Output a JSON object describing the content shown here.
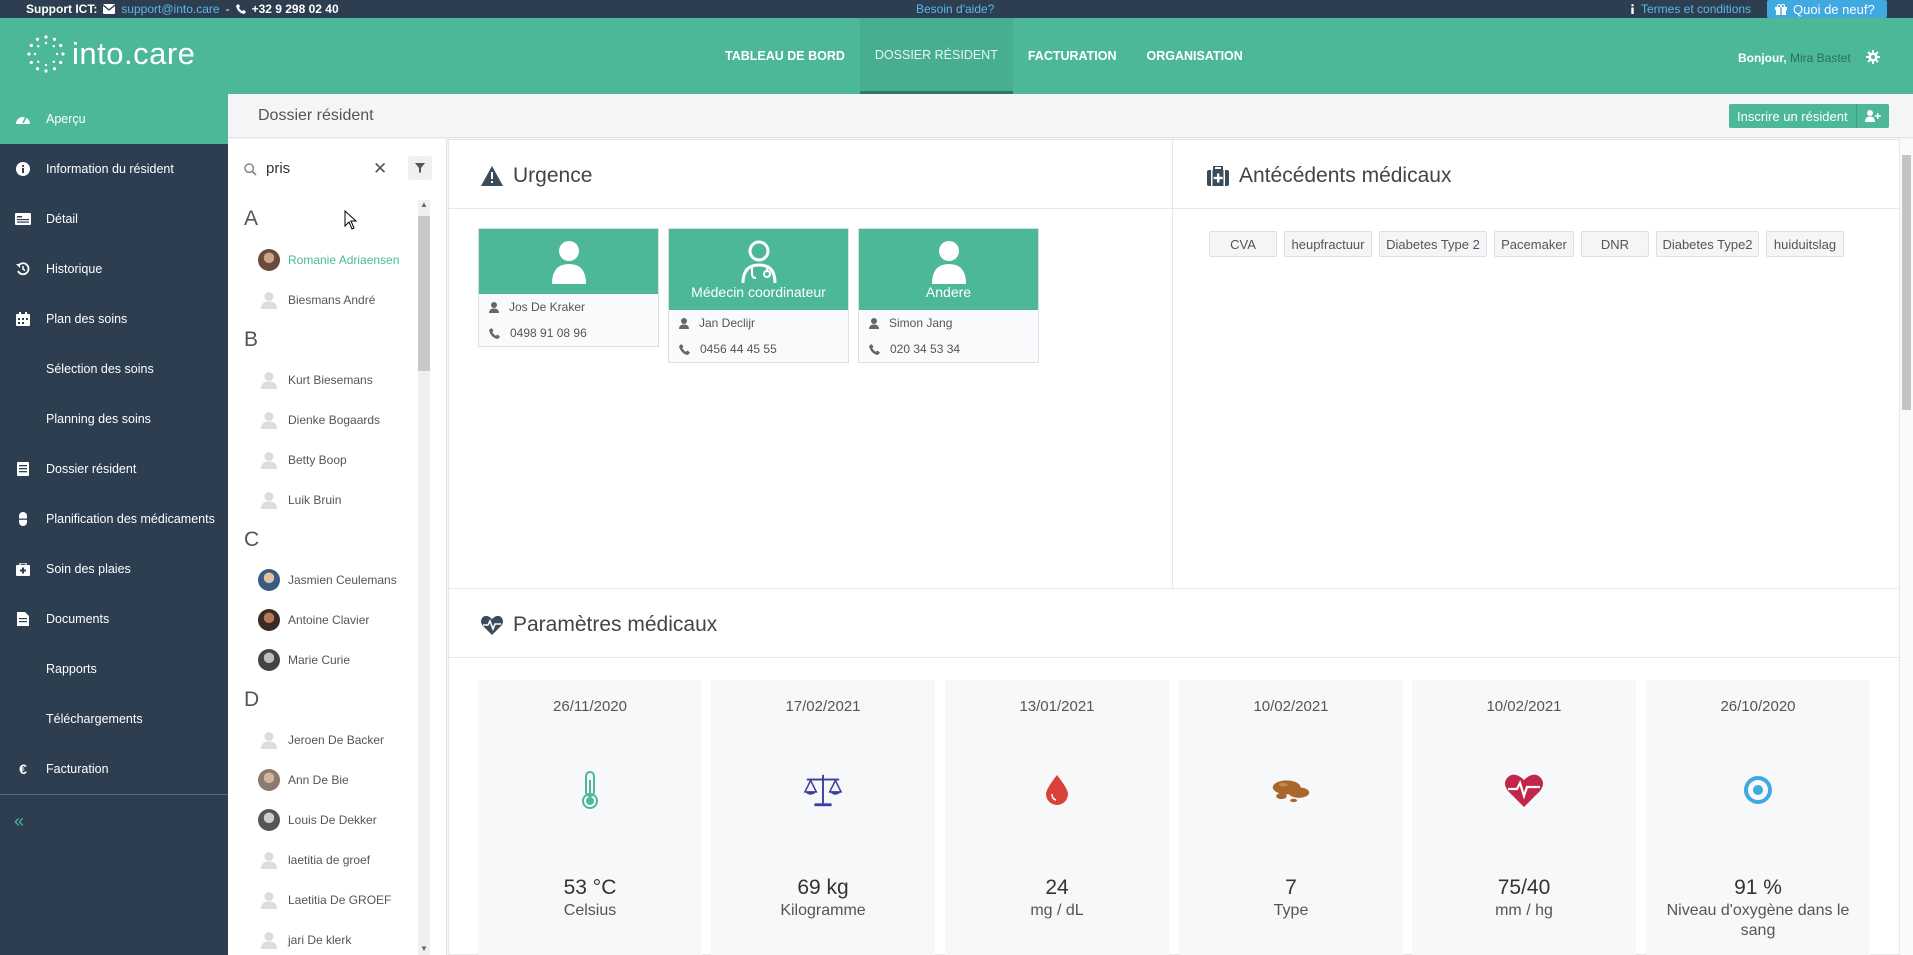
{
  "support": {
    "label": "Support ICT:",
    "email": "support@into.care",
    "sep": "-",
    "phone": "+32 9 298 02 40",
    "help": "Besoin d'aide?",
    "terms": "Termes et conditions",
    "whats_new": "Quoi de neuf?"
  },
  "header": {
    "logo": "into.care",
    "nav": [
      "TABLEAU DE BORD",
      "DOSSIER RÉSIDENT",
      "FACTURATION",
      "ORGANISATION"
    ],
    "greeting": "Bonjour,",
    "user": "Mira Bastet"
  },
  "sidebar": {
    "items": [
      {
        "label": "Aperçu",
        "icon": "dashboard-icon"
      },
      {
        "label": "Information du résident",
        "icon": "info-icon"
      },
      {
        "label": "Détail",
        "icon": "id-card-icon"
      },
      {
        "label": "Historique",
        "icon": "history-icon"
      },
      {
        "label": "Plan des soins",
        "icon": "calendar-icon"
      },
      {
        "label": "Sélection des soins",
        "icon": ""
      },
      {
        "label": "Planning des soins",
        "icon": ""
      },
      {
        "label": "Dossier résident",
        "icon": "list-icon"
      },
      {
        "label": "Planification des médicaments",
        "icon": "pill-icon"
      },
      {
        "label": "Soin des plaies",
        "icon": "first-aid-icon"
      },
      {
        "label": "Documents",
        "icon": "document-icon"
      },
      {
        "label": "Rapports",
        "icon": ""
      },
      {
        "label": "Téléchargements",
        "icon": ""
      },
      {
        "label": "Facturation",
        "icon": "euro-icon"
      }
    ],
    "collapse": "«"
  },
  "subheader": {
    "title": "Dossier résident",
    "register_button": "Inscrire un résident"
  },
  "search": {
    "value": "pris",
    "placeholder": ""
  },
  "residents": {
    "groups": [
      {
        "letter": "A",
        "items": [
          {
            "name": "Romanie Adriaensen",
            "photo": true,
            "selected": true
          },
          {
            "name": "Biesmans André",
            "photo": false
          }
        ]
      },
      {
        "letter": "B",
        "items": [
          {
            "name": "Kurt Biesemans",
            "photo": false
          },
          {
            "name": "Dienke Bogaards",
            "photo": false
          },
          {
            "name": "Betty Boop",
            "photo": false
          },
          {
            "name": "Luik Bruin",
            "photo": false
          }
        ]
      },
      {
        "letter": "C",
        "items": [
          {
            "name": "Jasmien Ceulemans",
            "photo": true
          },
          {
            "name": "Antoine Clavier",
            "photo": true
          },
          {
            "name": "Marie Curie",
            "photo": true
          }
        ]
      },
      {
        "letter": "D",
        "items": [
          {
            "name": "Jeroen De Backer",
            "photo": false
          },
          {
            "name": "Ann De Bie",
            "photo": true,
            "case": true
          },
          {
            "name": "Louis De Dekker",
            "photo": true
          },
          {
            "name": "laetitia de groef",
            "photo": false
          },
          {
            "name": "Laetitia De GROEF",
            "photo": false,
            "case": true
          },
          {
            "name": "jari De klerk",
            "photo": false
          }
        ]
      }
    ]
  },
  "urgence": {
    "title": "Urgence",
    "contacts": [
      {
        "role": "",
        "name": "Jos De Kraker",
        "phone": "0498 91 08 96"
      },
      {
        "role": "Médecin coordinateur",
        "name": "Jan Declijr",
        "phone": "0456 44 45 55"
      },
      {
        "role": "Andere",
        "name": "Simon Jang",
        "phone": "020 34 53 34"
      }
    ]
  },
  "antecedents": {
    "title": "Antécédents médicaux",
    "tags": [
      "CVA",
      "heupfractuur",
      "Diabetes Type 2",
      "Pacemaker",
      "DNR",
      "Diabetes Type2",
      "huiduitslag"
    ]
  },
  "parameters": {
    "title": "Paramètres médicaux",
    "items": [
      {
        "date": "26/11/2020",
        "value": "53 °C",
        "unit": "Celsius",
        "icon": "thermometer-icon",
        "color": "#4cb898"
      },
      {
        "date": "17/02/2021",
        "value": "69 kg",
        "unit": "Kilogramme",
        "icon": "scale-icon",
        "color": "#3b3f9e"
      },
      {
        "date": "13/01/2021",
        "value": "24",
        "unit": "mg / dL",
        "icon": "blood-drop-icon",
        "color": "#d9423b"
      },
      {
        "date": "10/02/2021",
        "value": "7",
        "unit": "Type",
        "icon": "stool-icon",
        "color": "#a9672e"
      },
      {
        "date": "10/02/2021",
        "value": "75/40",
        "unit": "mm / hg",
        "icon": "heartbeat-icon",
        "color": "#c2254a"
      },
      {
        "date": "26/10/2020",
        "value": "91 %",
        "unit": "Niveau d'oxygène dans le sang",
        "icon": "oxygen-icon",
        "color": "#3fa9e0"
      }
    ]
  },
  "colors": {
    "primary": "#4cb898",
    "dark": "#2d3e50",
    "accent_blue": "#3fa9e0"
  }
}
